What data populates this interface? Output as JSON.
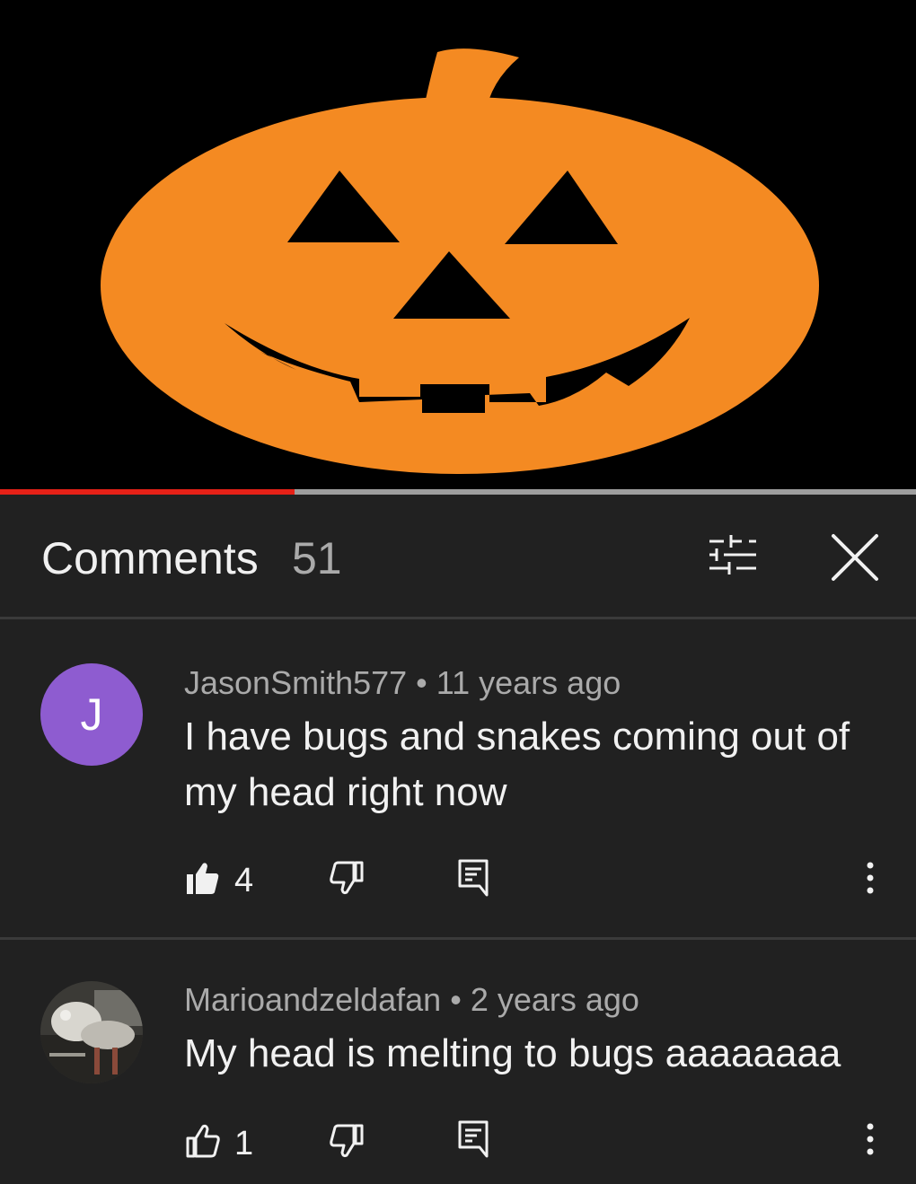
{
  "player": {
    "progress_fraction": 0.322,
    "colors": {
      "background": "#000000",
      "pumpkin": "#f48a22",
      "progress": "#e62117"
    }
  },
  "comments_panel": {
    "title": "Comments",
    "count": "51",
    "filter_icon": "sliders-icon",
    "close_icon": "close-icon"
  },
  "comments": [
    {
      "avatar_letter": "J",
      "avatar_color": "#8e5cd0",
      "author": "JasonSmith577",
      "separator": "•",
      "time": "11 years ago",
      "text": "I have bugs and snakes coming out of my head right now",
      "likes": "4",
      "liked": true
    },
    {
      "avatar_letter": "",
      "author": "Marioandzeldafan",
      "separator": "•",
      "time": "2 years ago",
      "text": "My head is melting to bugs aaaaaaaa",
      "likes": "1",
      "liked": false
    }
  ]
}
